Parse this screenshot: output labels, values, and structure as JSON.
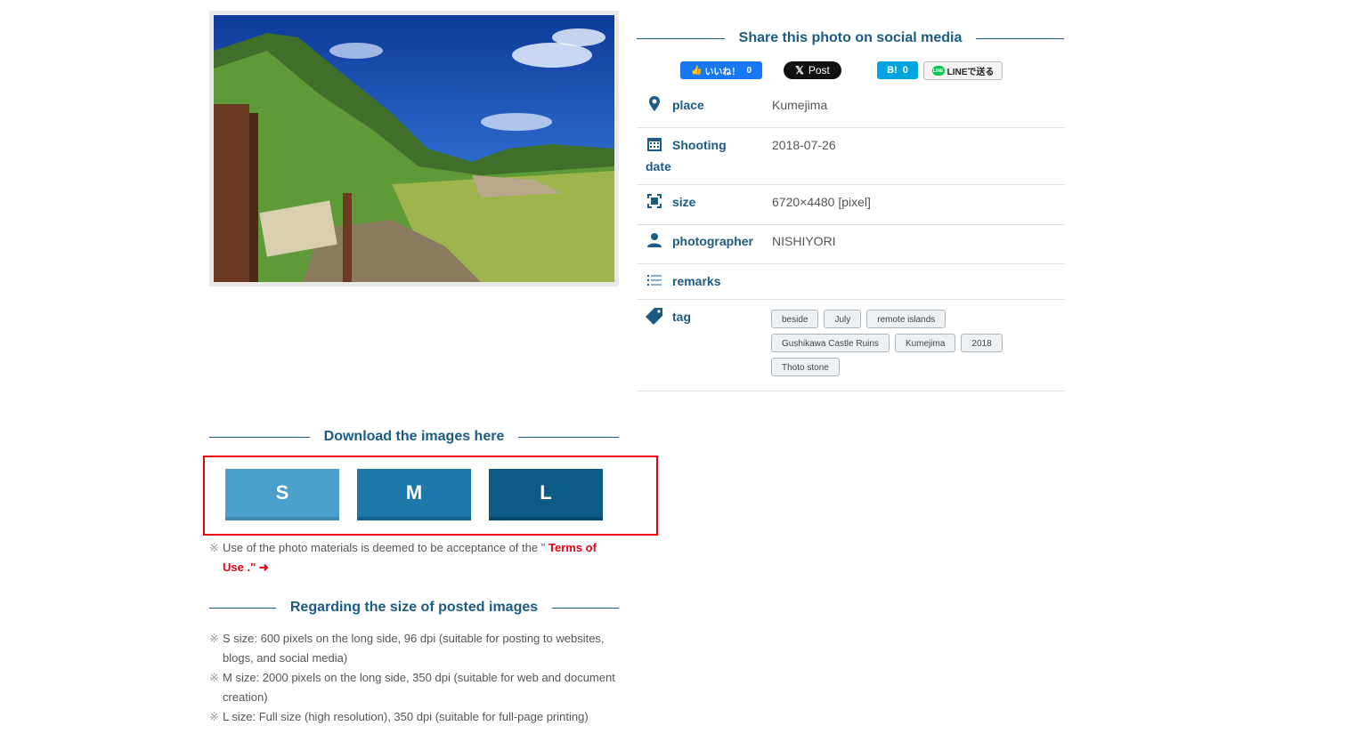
{
  "social": {
    "heading": "Share this photo on social media",
    "facebook_label": "いいね！",
    "facebook_count": "0",
    "x_label": "Post",
    "hatena_label": "B!",
    "hatena_count": "0",
    "line_label": "LINEで送る",
    "line_logo_text": "LINE"
  },
  "info": {
    "place_label": "place",
    "place_value": "Kumejima",
    "date_label_1": "Shooting",
    "date_label_2": "date",
    "date_value": "2018-07-26",
    "size_label": "size",
    "size_value": "6720×4480 [pixel]",
    "photographer_label": "photographer",
    "photographer_value": "NISHIYORI",
    "remarks_label": "remarks",
    "tag_label": "tag",
    "tags": [
      "beside",
      "July",
      "remote islands",
      "Gushikawa Castle Ruins",
      "Kumejima",
      "2018",
      "Thoto stone"
    ]
  },
  "download": {
    "heading": "Download the images here",
    "buttons": [
      "S",
      "M",
      "L"
    ],
    "terms_prefix": "Use of the photo materials is deemed to be acceptance of the \"",
    "terms_link": "Terms of Use .\"",
    "note_mark": "※"
  },
  "sizes": {
    "heading": "Regarding the size of posted images",
    "notes": [
      "S size: 600 pixels on the long side, 96 dpi (suitable for posting to websites, blogs, and social media)",
      "M size: 2000 pixels on the long side, 350 dpi (suitable for web and document creation)",
      "L size: Full size (high resolution), 350 dpi (suitable for full-page printing)"
    ]
  },
  "colors": {
    "accent": "#1b5b84",
    "btn_s": "#4aa0cc",
    "btn_m": "#1b78a8",
    "btn_l": "#0b5b86",
    "highlight_border": "#e60012"
  }
}
